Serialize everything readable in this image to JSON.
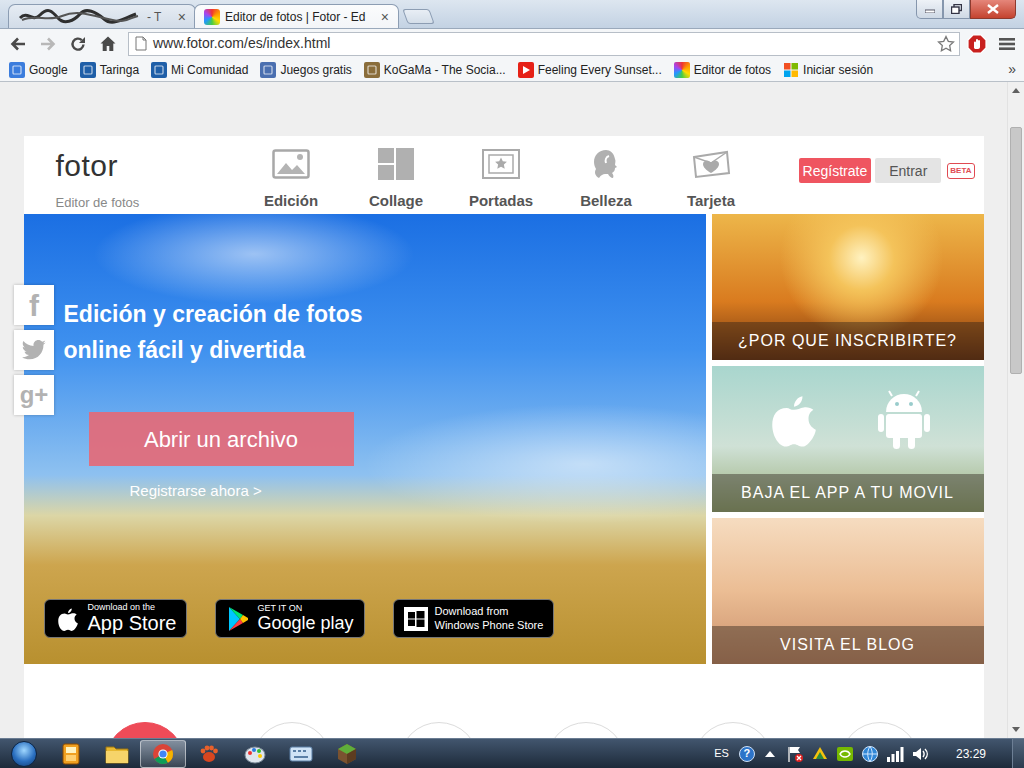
{
  "browser": {
    "tabs": [
      {
        "label": "- T",
        "close": "×",
        "selected": false,
        "redacted": true
      },
      {
        "label": "Editor de fotos | Fotor - Ed",
        "close": "×",
        "selected": true,
        "redacted": false
      }
    ],
    "url": "www.fotor.com/es/index.html",
    "bookmarks": [
      {
        "label": "Google",
        "kind": "square",
        "color": "#3b7ddd"
      },
      {
        "label": "Taringa",
        "kind": "square",
        "color": "#1f5fa8"
      },
      {
        "label": "Mi Comunidad",
        "kind": "square",
        "color": "#1f5fa8"
      },
      {
        "label": "Juegos gratis",
        "kind": "square",
        "color": "#4a6fb0"
      },
      {
        "label": "KoGaMa - The Socia...",
        "kind": "square",
        "color": "#8a6d3b"
      },
      {
        "label": "Feeling Every Sunset...",
        "kind": "youtube",
        "color": "#e62117"
      },
      {
        "label": "Editor de fotos",
        "kind": "rainbow"
      },
      {
        "label": "Iniciar sesión",
        "kind": "windows"
      }
    ],
    "bookmarks_more": "»"
  },
  "site": {
    "logo": "fotor",
    "tagline": "Editor de fotos",
    "nav": [
      {
        "label": "Edición",
        "kind": "edit"
      },
      {
        "label": "Collage",
        "kind": "collage"
      },
      {
        "label": "Portadas",
        "kind": "cover"
      },
      {
        "label": "Belleza",
        "kind": "beauty"
      },
      {
        "label": "Tarjeta",
        "kind": "card"
      }
    ],
    "register": "Regístrate",
    "login": "Entrar",
    "beta": "BETA"
  },
  "hero": {
    "title_lines": [
      "Edición y creación de fotos",
      "online fácil y divertida"
    ],
    "open_button": "Abrir un archivo",
    "register_link": "Registrarse ahora >",
    "stores": [
      {
        "kind": "apple",
        "small": "Download on the",
        "big": "App Store"
      },
      {
        "kind": "google",
        "small": "GET IT ON",
        "big": "Google play"
      },
      {
        "kind": "windows",
        "small": "Download from",
        "big": "Windows Phone Store"
      }
    ]
  },
  "tiles": [
    {
      "label": "¿POR QUE INSCRIBIRTE?",
      "kind": "sunset"
    },
    {
      "label": "BAJA EL APP A TU MOVIL",
      "kind": "apps"
    },
    {
      "label": "VISITA EL BLOG",
      "kind": "beach"
    }
  ],
  "social": [
    {
      "kind": "facebook",
      "text": "f"
    },
    {
      "kind": "twitter"
    },
    {
      "kind": "google",
      "text": "g+"
    }
  ],
  "features": [
    {
      "selected": true
    },
    {
      "selected": false
    },
    {
      "selected": false
    },
    {
      "selected": false
    },
    {
      "selected": false
    },
    {
      "selected": false
    }
  ],
  "scrollbar": {
    "level": 0.4
  },
  "taskbar": {
    "apps": [
      {
        "kind": "media",
        "selected": false
      },
      {
        "kind": "folder",
        "selected": false
      },
      {
        "kind": "chrome",
        "selected": true
      },
      {
        "kind": "paw",
        "selected": false
      },
      {
        "kind": "paint",
        "selected": false
      },
      {
        "kind": "keyboard",
        "selected": false
      },
      {
        "kind": "cube",
        "selected": false
      }
    ],
    "language": "ES",
    "help": "?",
    "tray": [
      {
        "kind": "arrow"
      },
      {
        "kind": "flag"
      },
      {
        "kind": "colors"
      },
      {
        "kind": "nvidia"
      },
      {
        "kind": "globe"
      },
      {
        "kind": "network"
      },
      {
        "kind": "volume"
      }
    ],
    "clock": "23:29"
  }
}
